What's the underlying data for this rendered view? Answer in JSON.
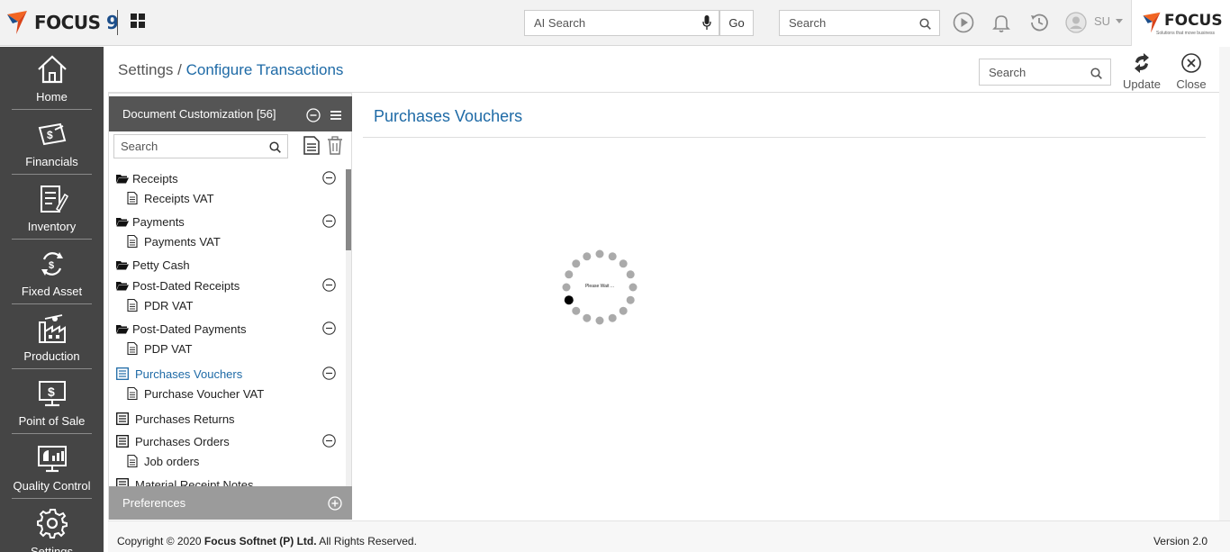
{
  "topbar": {
    "logo_text": "FOCUS",
    "logo_version": "9",
    "ai_search_placeholder": "AI Search",
    "go_label": "Go",
    "search_placeholder": "Search",
    "user_initials": "SU",
    "brand_text": "FOCUS",
    "brand_tagline": "Solutions that move business"
  },
  "sidebar": {
    "items": [
      {
        "label": "Home",
        "icon": "home-icon"
      },
      {
        "label": "Financials",
        "icon": "financials-icon"
      },
      {
        "label": "Inventory",
        "icon": "inventory-icon"
      },
      {
        "label": "Fixed Asset",
        "icon": "fixed-asset-icon"
      },
      {
        "label": "Production",
        "icon": "production-icon"
      },
      {
        "label": "Point of Sale",
        "icon": "point-of-sale-icon"
      },
      {
        "label": "Quality Control",
        "icon": "quality-control-icon"
      },
      {
        "label": "Settings",
        "icon": "settings-icon"
      }
    ]
  },
  "header": {
    "breadcrumb_root": "Settings",
    "breadcrumb_sep": " / ",
    "breadcrumb_current": "Configure Transactions",
    "search_placeholder": "Search",
    "update_label": "Update",
    "close_label": "Close"
  },
  "panel": {
    "title": "Document Customization [56]",
    "search_placeholder": "Search",
    "tree": [
      {
        "label": "Receipts",
        "type": "folder",
        "collapsible": true
      },
      {
        "label": "Receipts VAT",
        "type": "doc",
        "collapsible": false
      },
      {
        "label": "Payments",
        "type": "folder",
        "collapsible": true
      },
      {
        "label": "Payments VAT",
        "type": "doc",
        "collapsible": false
      },
      {
        "label": "Petty Cash",
        "type": "folder",
        "collapsible": false
      },
      {
        "label": "Post-Dated Receipts",
        "type": "folder",
        "collapsible": true
      },
      {
        "label": "PDR VAT",
        "type": "doc",
        "collapsible": false
      },
      {
        "label": "Post-Dated Payments",
        "type": "folder",
        "collapsible": true
      },
      {
        "label": "PDP VAT",
        "type": "doc",
        "collapsible": false
      },
      {
        "label": "Purchases Vouchers",
        "type": "list",
        "collapsible": true,
        "active": true
      },
      {
        "label": "Purchase Voucher VAT",
        "type": "doc",
        "collapsible": false
      },
      {
        "label": "Purchases Returns",
        "type": "list",
        "collapsible": false
      },
      {
        "label": "Purchases Orders",
        "type": "list",
        "collapsible": true
      },
      {
        "label": "Job orders",
        "type": "doc",
        "collapsible": false
      },
      {
        "label": "Material Receipt Notes",
        "type": "list",
        "collapsible": false
      }
    ],
    "footer_label": "Preferences"
  },
  "content": {
    "title": "Purchases Vouchers",
    "loading_text": "Please Wait ..."
  },
  "footer": {
    "copyright_prefix": "Copyright © 2020 ",
    "company": "Focus Softnet (P) Ltd.",
    "rights": " All Rights Reserved.",
    "version": "Version 2.0"
  },
  "colors": {
    "accent": "#1e6aa6",
    "sidebar_bg": "#454545",
    "panel_header_bg": "#555555",
    "panel_footer_bg": "#9b9b9b",
    "brand_orange": "#f26522"
  }
}
